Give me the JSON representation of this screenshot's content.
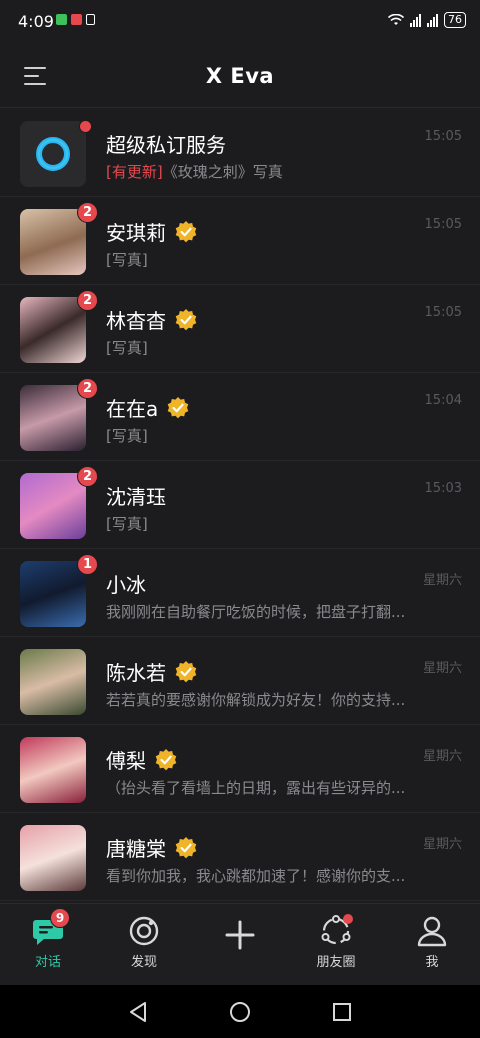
{
  "status_bar": {
    "time": "4:09",
    "battery": "76"
  },
  "header": {
    "title": "X Eva"
  },
  "conversations": [
    {
      "name": "超级私订服务",
      "preview_highlight": "[有更新]",
      "preview": "《玫瑰之刺》写真",
      "time": "15:05",
      "verified": false,
      "badge": ""
    },
    {
      "name": "安琪莉",
      "preview_highlight": "",
      "preview": "[写真]",
      "time": "15:05",
      "verified": true,
      "badge": "2"
    },
    {
      "name": "林杳杳",
      "preview_highlight": "",
      "preview": "[写真]",
      "time": "15:05",
      "verified": true,
      "badge": "2"
    },
    {
      "name": "在在a",
      "preview_highlight": "",
      "preview": "[写真]",
      "time": "15:04",
      "verified": true,
      "badge": "2"
    },
    {
      "name": "沈清珏",
      "preview_highlight": "",
      "preview": "[写真]",
      "time": "15:03",
      "verified": false,
      "badge": "2"
    },
    {
      "name": "小冰",
      "preview_highlight": "",
      "preview": "我刚刚在自助餐厅吃饭的时候，把盘子打翻...",
      "time": "星期六",
      "verified": false,
      "badge": "1"
    },
    {
      "name": "陈水若",
      "preview_highlight": "",
      "preview": "若若真的要感谢你解锁成为好友！你的支持...",
      "time": "星期六",
      "verified": true,
      "badge": ""
    },
    {
      "name": "傅梨",
      "preview_highlight": "",
      "preview": "（抬头看了看墙上的日期，露出有些讶异的...",
      "time": "星期六",
      "verified": true,
      "badge": ""
    },
    {
      "name": "唐糖棠",
      "preview_highlight": "",
      "preview": "看到你加我，我心跳都加速了！感谢你的支...",
      "time": "星期六",
      "verified": true,
      "badge": ""
    }
  ],
  "bottom_nav": {
    "chat": {
      "label": "对话",
      "badge": "9"
    },
    "discover": {
      "label": "发现"
    },
    "moments": {
      "label": "朋友圈"
    },
    "me": {
      "label": "我"
    }
  },
  "colors": {
    "accent": "#2ec9a7",
    "badge": "#e5484d",
    "background": "#1c1c1e"
  }
}
